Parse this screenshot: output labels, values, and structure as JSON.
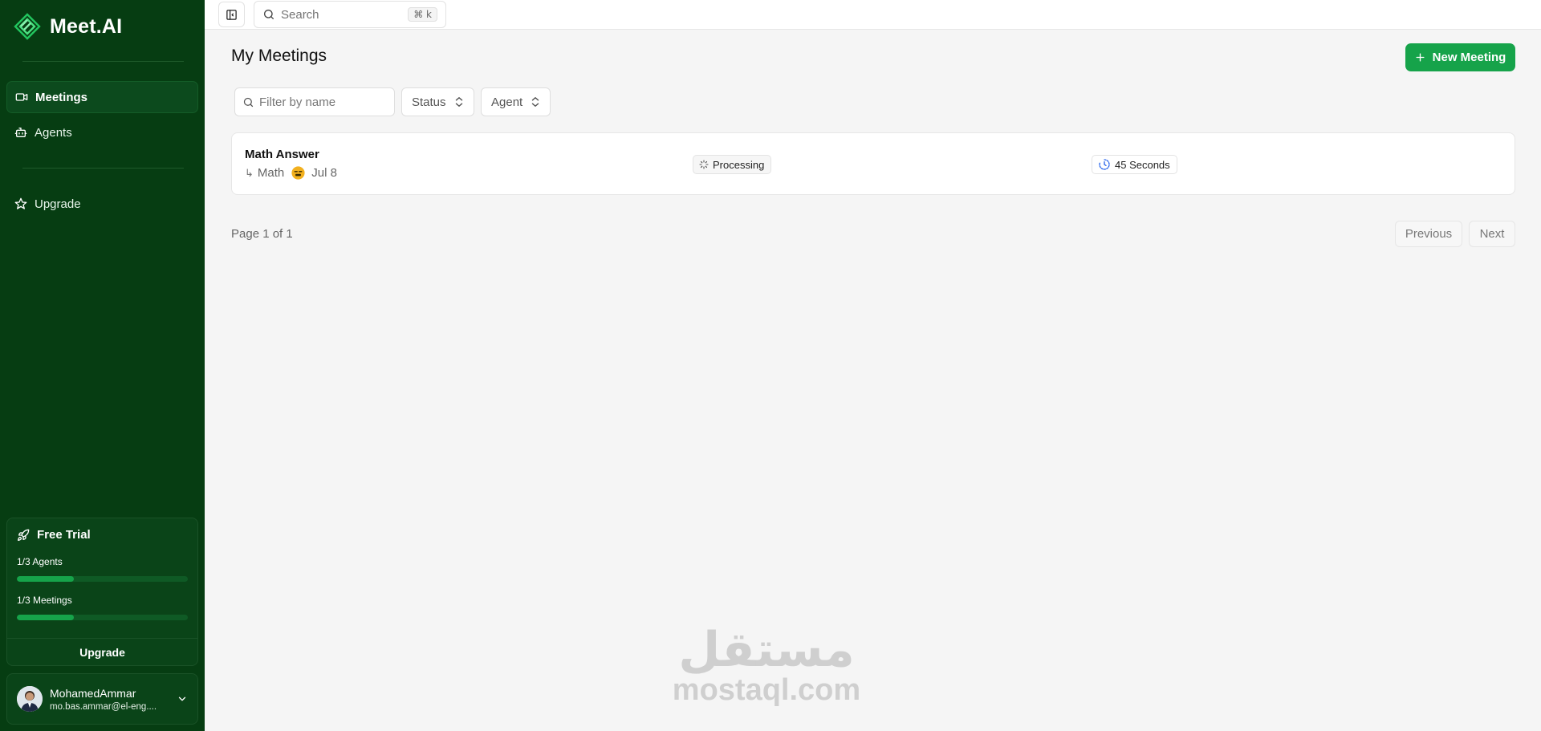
{
  "app": {
    "name": "Meet.AI"
  },
  "sidebar": {
    "items": [
      {
        "label": "Meetings",
        "icon": "video-icon",
        "active": true
      },
      {
        "label": "Agents",
        "icon": "bot-icon",
        "active": false
      }
    ],
    "upgrade_item": {
      "label": "Upgrade",
      "icon": "star-icon"
    },
    "trial": {
      "title": "Free Trial",
      "agents_label": "1/3 Agents",
      "agents_progress": 0.333,
      "meetings_label": "1/3 Meetings",
      "meetings_progress": 0.333,
      "upgrade_label": "Upgrade"
    },
    "user": {
      "name": "MohamedAmmar",
      "email": "mo.bas.ammar@el-eng...."
    }
  },
  "topbar": {
    "search_placeholder": "Search",
    "shortcut": "⌘ k"
  },
  "main": {
    "title": "My Meetings",
    "new_button_label": "New Meeting",
    "filters": {
      "name_placeholder": "Filter by name",
      "status_label": "Status",
      "agent_label": "Agent"
    },
    "meetings": [
      {
        "title": "Math Answer",
        "agent": "Math",
        "date": "Jul 8",
        "status": "Processing",
        "duration": "45 Seconds"
      }
    ],
    "pagination": {
      "info": "Page 1 of 1",
      "previous_label": "Previous",
      "next_label": "Next"
    }
  },
  "watermark": {
    "arabic": "مستقل",
    "latin": "mostaql.com"
  },
  "colors": {
    "sidebar_bg": "#063d12",
    "accent": "#16a34a",
    "page_bg": "#f5f5f5"
  }
}
